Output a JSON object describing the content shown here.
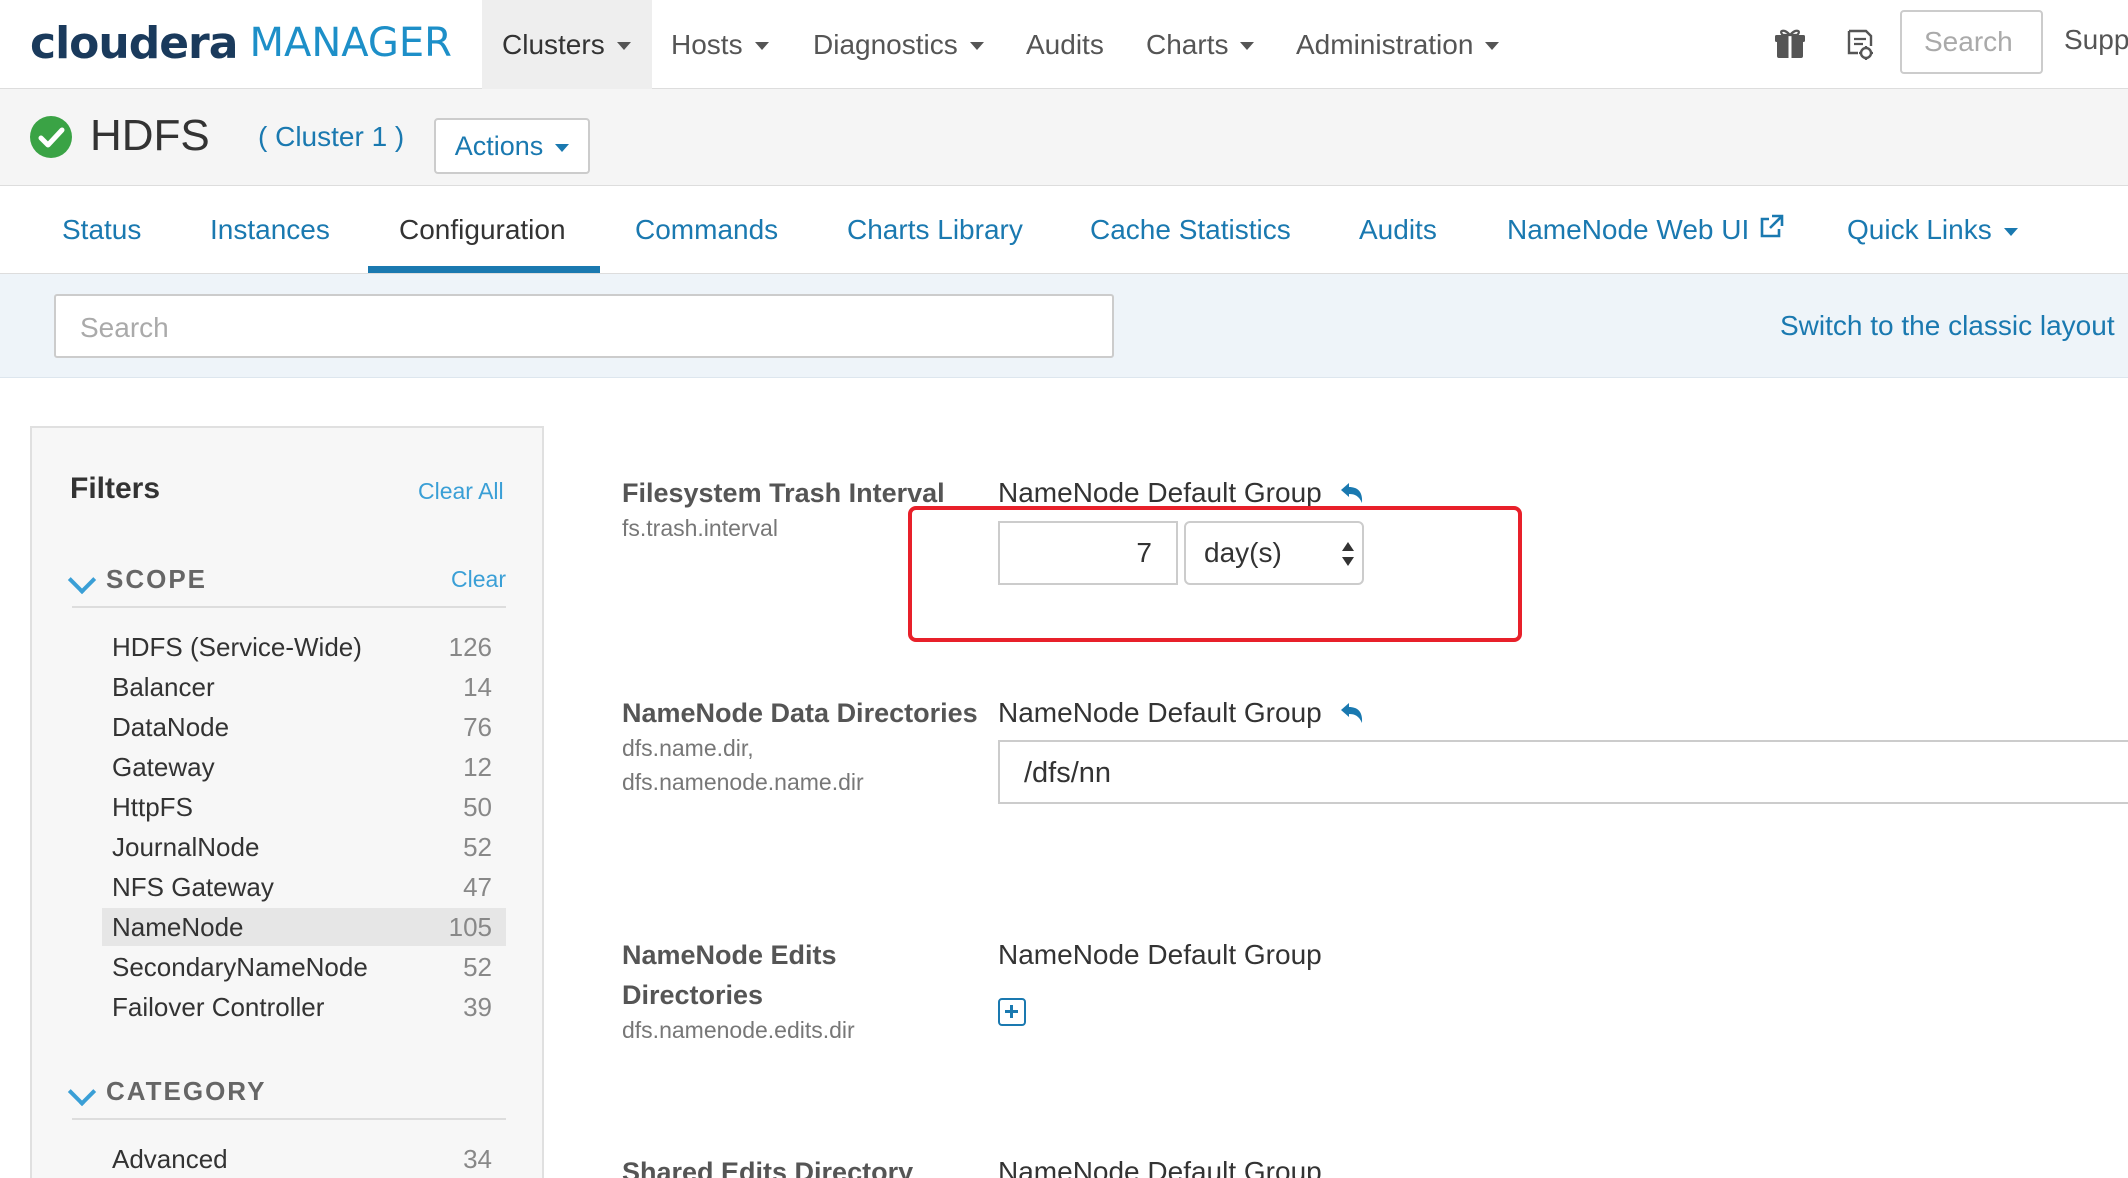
{
  "app": {
    "brand": "cloudera",
    "product": "MANAGER"
  },
  "topnav": {
    "items": [
      {
        "label": "Clusters",
        "dropdown": true,
        "active": true
      },
      {
        "label": "Hosts",
        "dropdown": true
      },
      {
        "label": "Diagnostics",
        "dropdown": true
      },
      {
        "label": "Audits",
        "dropdown": false
      },
      {
        "label": "Charts",
        "dropdown": true
      },
      {
        "label": "Administration",
        "dropdown": true
      }
    ],
    "icons": [
      "gift-icon",
      "parcel-icon"
    ],
    "search_placeholder": "Search",
    "support_label": "Supp"
  },
  "service": {
    "status": "good-health",
    "name": "HDFS",
    "cluster": "( Cluster 1 )",
    "actions_label": "Actions"
  },
  "tabs": [
    {
      "label": "Status"
    },
    {
      "label": "Instances"
    },
    {
      "label": "Configuration",
      "active": true
    },
    {
      "label": "Commands"
    },
    {
      "label": "Charts Library"
    },
    {
      "label": "Cache Statistics"
    },
    {
      "label": "Audits"
    },
    {
      "label": "NameNode Web UI",
      "external": true
    },
    {
      "label": "Quick Links",
      "dropdown": true
    }
  ],
  "config_search": {
    "placeholder": "Search",
    "classic_layout_link": "Switch to the classic layout"
  },
  "filters": {
    "title": "Filters",
    "clear_all": "Clear All",
    "scope": {
      "title": "SCOPE",
      "clear": "Clear",
      "items": [
        {
          "label": "HDFS (Service-Wide)",
          "count": "126"
        },
        {
          "label": "Balancer",
          "count": "14"
        },
        {
          "label": "DataNode",
          "count": "76"
        },
        {
          "label": "Gateway",
          "count": "12"
        },
        {
          "label": "HttpFS",
          "count": "50"
        },
        {
          "label": "JournalNode",
          "count": "52"
        },
        {
          "label": "NFS Gateway",
          "count": "47"
        },
        {
          "label": "NameNode",
          "count": "105",
          "selected": true
        },
        {
          "label": "SecondaryNameNode",
          "count": "52"
        },
        {
          "label": "Failover Controller",
          "count": "39"
        }
      ]
    },
    "category": {
      "title": "CATEGORY",
      "items": [
        {
          "label": "Advanced",
          "count": "34"
        }
      ]
    }
  },
  "configs": [
    {
      "name": "Filesystem Trash Interval",
      "keys": [
        "fs.trash.interval"
      ],
      "group": "NameNode Default Group",
      "value": "7",
      "unit": "day(s)"
    },
    {
      "name": "NameNode Data Directories",
      "keys": [
        "dfs.name.dir,",
        "dfs.namenode.name.dir"
      ],
      "group": "NameNode Default Group",
      "value": "/dfs/nn"
    },
    {
      "name_lines": [
        "NameNode Edits",
        "Directories"
      ],
      "keys": [
        "dfs.namenode.edits.dir"
      ],
      "group": "NameNode Default Group"
    },
    {
      "name": "Shared Edits Directory",
      "group": "NameNode Default Group"
    }
  ],
  "colors": {
    "accent": "#1a79b0",
    "link_light": "#3a9fd6",
    "status_ok": "#3aa345",
    "highlight": "#e8202a"
  }
}
